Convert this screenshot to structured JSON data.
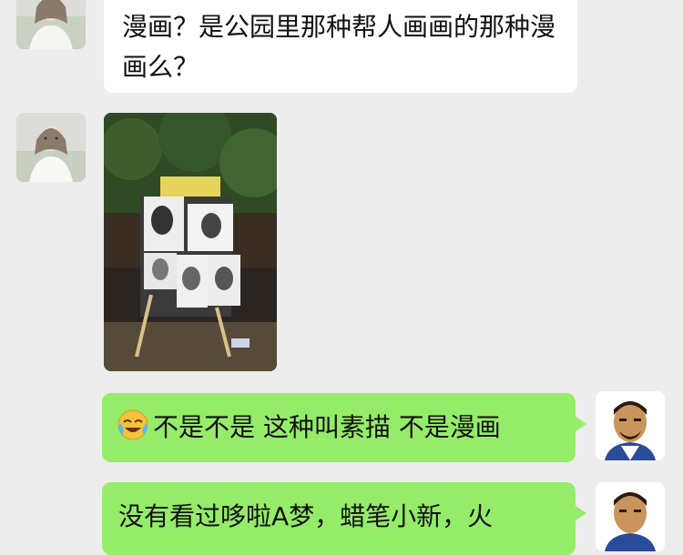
{
  "messages": [
    {
      "side": "in",
      "type": "text",
      "text": "漫画？是公园里那种帮人画画的那种漫画么？"
    },
    {
      "side": "in",
      "type": "image",
      "alt": "street sketch artist portraits on easel"
    },
    {
      "side": "out",
      "type": "text",
      "emoji": "crying-laughing-emoji",
      "text": "不是不是 这种叫素描 不是漫画"
    },
    {
      "side": "out",
      "type": "text",
      "text": "没有看过哆啦A梦，蜡笔小新，火"
    }
  ],
  "colors": {
    "background": "#ededed",
    "incoming_bubble": "#ffffff",
    "outgoing_bubble": "#95ec69"
  }
}
